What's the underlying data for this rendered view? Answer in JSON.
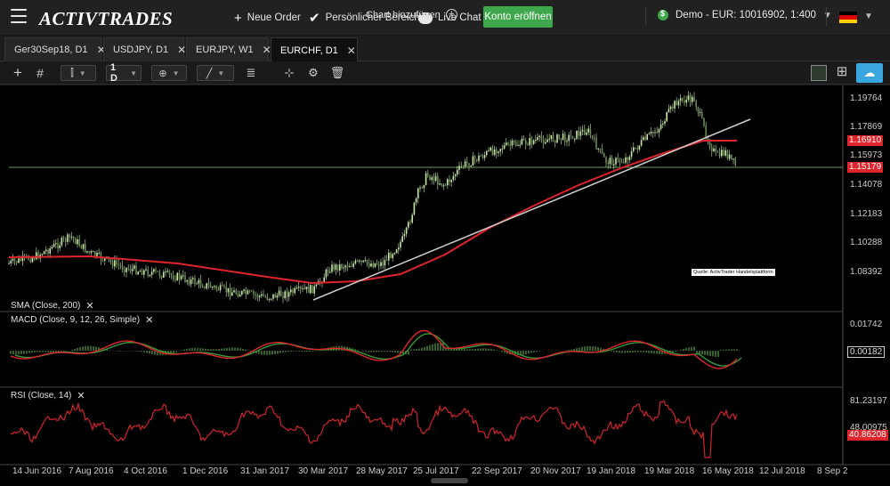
{
  "header": {
    "logo": "ACTIVTRADES",
    "new_order": "Neue Order",
    "personal_area": "Persönlicher Bereich",
    "live_chat": "Live Chat",
    "open_account": "Konto eröffnen",
    "account": "Demo - EUR: 10016902, 1:400",
    "language_flag": "de"
  },
  "tabs": [
    {
      "label": "Ger30Sep18, D1"
    },
    {
      "label": "USDJPY, D1"
    },
    {
      "label": "EURJPY, W1"
    },
    {
      "label": "EURCHF, D1",
      "active": true
    }
  ],
  "add_chart": "Chart hinzufügen",
  "toolbar": {
    "timeframe": "1 D"
  },
  "chart": {
    "instrument": "EURCHF, D1",
    "source_note": "Quelle: ActivTrader Handelsplattform",
    "price_axis": [
      "1.19764",
      "1.17869",
      "1.15973",
      "1.14078",
      "1.12183",
      "1.10288",
      "1.08392"
    ],
    "current_price": "1.15179",
    "sma_value": "1.16910",
    "indicators": {
      "sma": "SMA (Close, 200)",
      "macd": "MACD (Close, 9, 12, 26, Simple)",
      "rsi": "RSI (Close, 14)"
    },
    "macd_axis": [
      "0.01742",
      "0.00182"
    ],
    "rsi_axis": [
      "81.23197",
      "48.00975"
    ],
    "rsi_value": "40.86208",
    "dates": [
      "14 Jun 2016",
      "7 Aug 2016",
      "4 Oct 2016",
      "1 Dec 2016",
      "31 Jan 2017",
      "30 Mar 2017",
      "28 May 2017",
      "25 Jul 2017",
      "22 Sep 2017",
      "20 Nov 2017",
      "19 Jan 2018",
      "19 Mar 2018",
      "16 May 2018",
      "12 Jul 2018",
      "8 Sep 2"
    ],
    "colors": {
      "candle": "#c8e6a8",
      "sma": "#e0242b",
      "trendline": "#cfcfcf",
      "price_line": "#6f9a5c",
      "macd_line": "#e0242b",
      "signal_line": "#3a9a3a",
      "rsi": "#d0242b"
    }
  }
}
